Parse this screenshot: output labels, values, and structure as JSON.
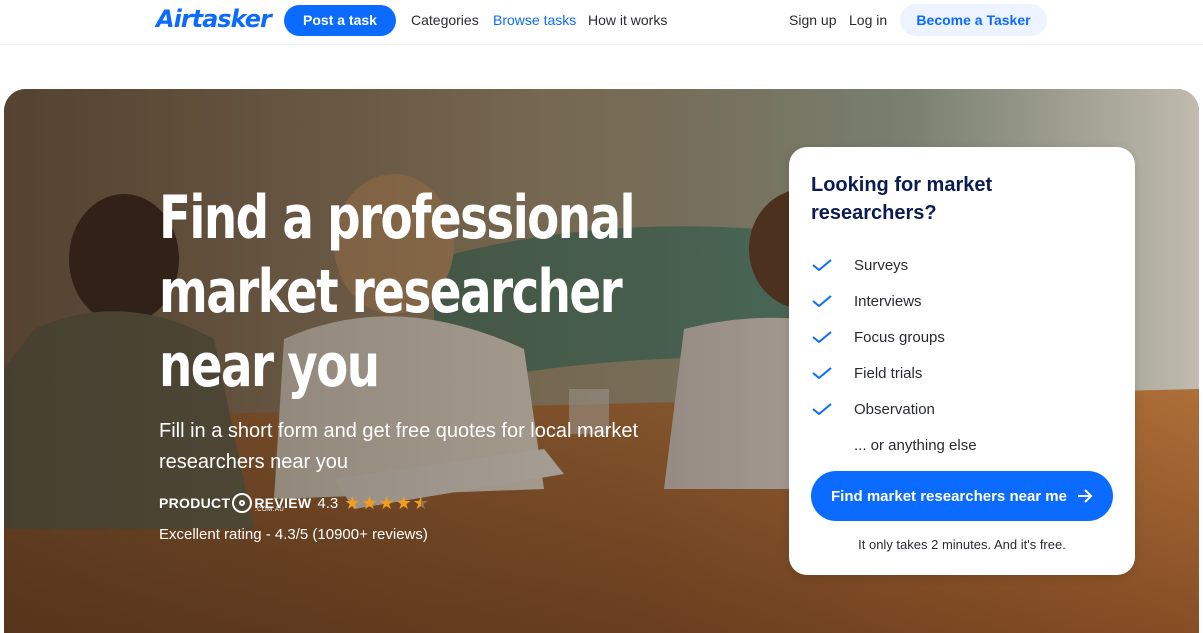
{
  "nav": {
    "logo": "Airtasker",
    "post_task": "Post a task",
    "categories": "Categories",
    "browse_tasks": "Browse tasks",
    "how_it_works": "How it works",
    "sign_up": "Sign up",
    "log_in": "Log in",
    "become_tasker": "Become a Tasker"
  },
  "hero": {
    "title_lines": [
      "Find a professional",
      "market researcher",
      "near you"
    ],
    "subtitle": "Fill in a short form and get free quotes for local market researchers near you",
    "rating": {
      "brand_left": "PRODUCT",
      "brand_right": "REVIEW",
      "brand_domain": ".COM.AU",
      "score": "4.3",
      "stars": 4.5,
      "summary": "Excellent rating - 4.3/5 (10900+ reviews)"
    }
  },
  "card": {
    "title": "Looking for market researchers?",
    "items": [
      {
        "label": "Surveys",
        "icon": "check-icon"
      },
      {
        "label": "Interviews",
        "icon": "check-icon"
      },
      {
        "label": "Focus groups",
        "icon": "check-icon"
      },
      {
        "label": "Field trials",
        "icon": "check-icon"
      },
      {
        "label": "Observation",
        "icon": "check-icon"
      },
      {
        "label": "... or anything else",
        "icon": ""
      }
    ],
    "cta": "Find market researchers near me",
    "note": "It only takes 2 minutes. And it's free."
  },
  "colors": {
    "brand_blue": "#0c6bff",
    "card_title": "#0a1b52",
    "star": "#f59d1a"
  }
}
